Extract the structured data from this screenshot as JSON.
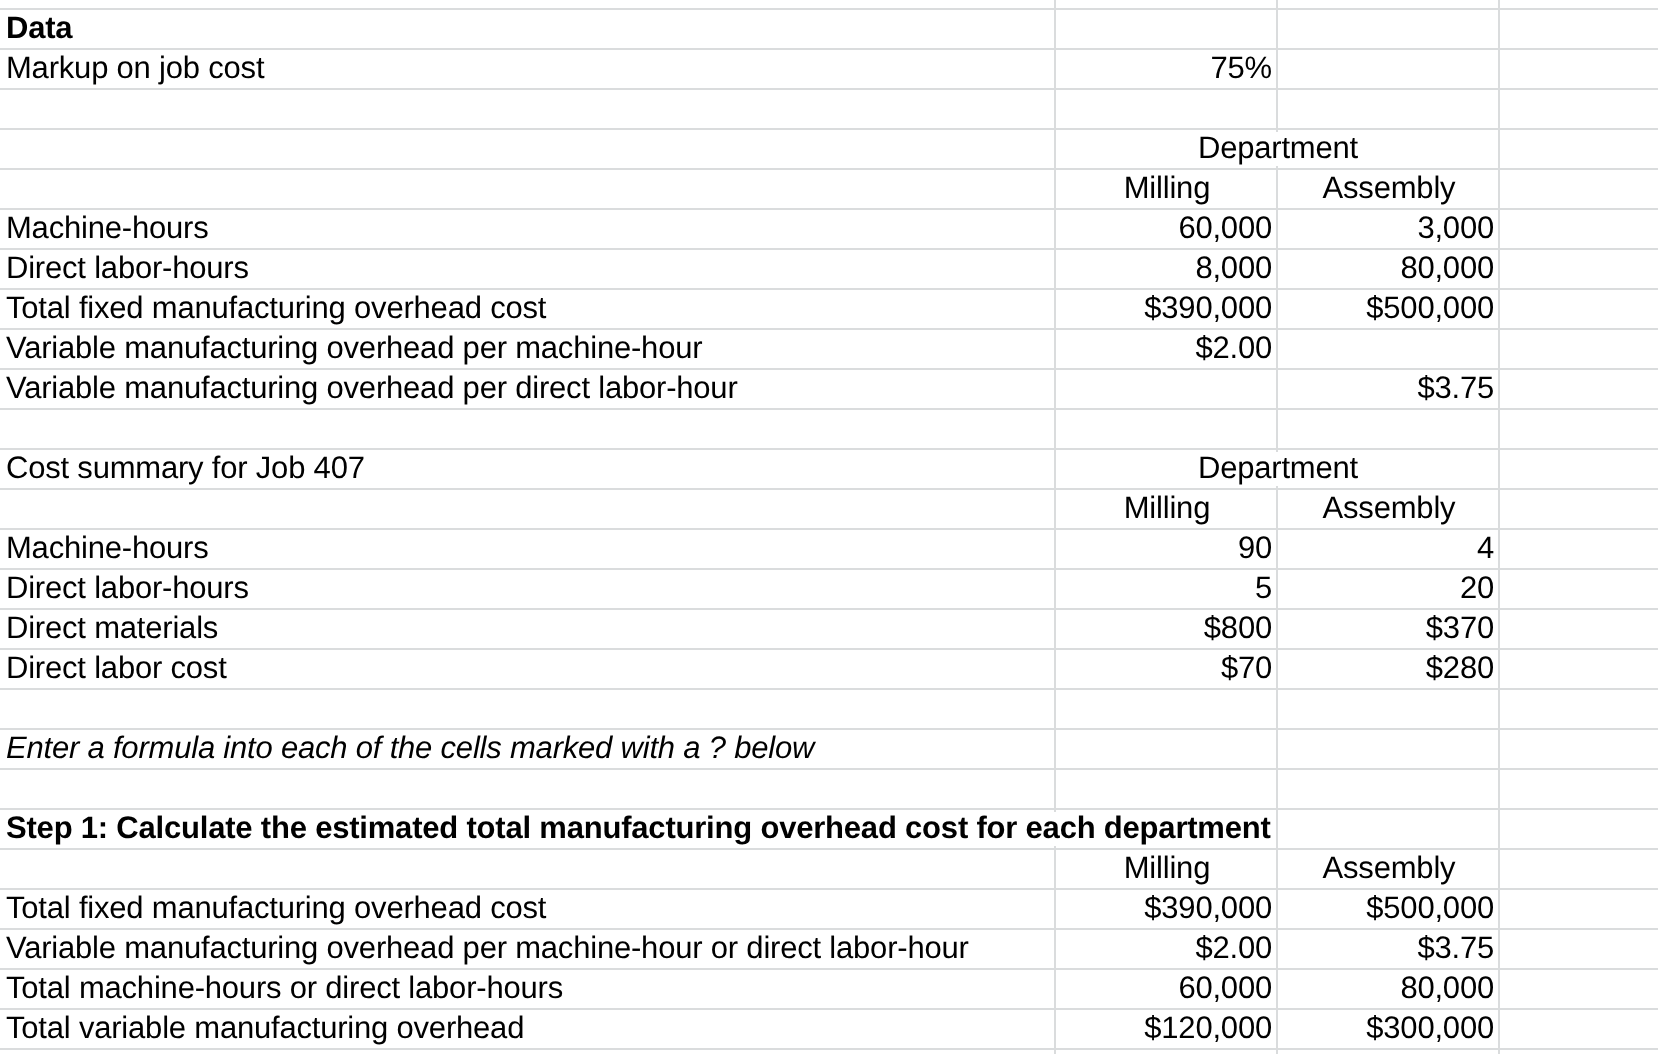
{
  "rows": [
    {
      "kind": "title",
      "label": "Data"
    },
    {
      "kind": "data",
      "label": "Markup on job cost",
      "milling": "75%"
    },
    {
      "kind": "blank"
    },
    {
      "kind": "header",
      "group": "Department"
    },
    {
      "kind": "columns",
      "milling": "Milling",
      "assembly": "Assembly"
    },
    {
      "kind": "data",
      "label": "Machine-hours",
      "milling": "60,000",
      "assembly": "3,000"
    },
    {
      "kind": "data",
      "label": "Direct labor-hours",
      "milling": "8,000",
      "assembly": "80,000"
    },
    {
      "kind": "data",
      "label": "Total fixed manufacturing overhead cost",
      "milling": "$390,000",
      "assembly": "$500,000"
    },
    {
      "kind": "data",
      "label": "Variable manufacturing overhead per machine-hour",
      "milling": "$2.00"
    },
    {
      "kind": "data",
      "label": "Variable manufacturing overhead per direct labor-hour",
      "assembly": "$3.75"
    },
    {
      "kind": "blank"
    },
    {
      "kind": "header",
      "label": "Cost summary for Job 407",
      "group": "Department"
    },
    {
      "kind": "columns",
      "milling": "Milling",
      "assembly": "Assembly"
    },
    {
      "kind": "data",
      "label": "Machine-hours",
      "milling": "90",
      "assembly": "4"
    },
    {
      "kind": "data",
      "label": "Direct labor-hours",
      "milling": "5",
      "assembly": "20"
    },
    {
      "kind": "data",
      "label": "Direct materials",
      "milling": "$800",
      "assembly": "$370"
    },
    {
      "kind": "data",
      "label": "Direct labor cost",
      "milling": "$70",
      "assembly": "$280"
    },
    {
      "kind": "blank"
    },
    {
      "kind": "note",
      "label": "Enter a formula into each of the cells marked with a ? below"
    },
    {
      "kind": "blank"
    },
    {
      "kind": "title",
      "label": "Step 1: Calculate the estimated total manufacturing overhead cost for each department"
    },
    {
      "kind": "columns",
      "milling": "Milling",
      "assembly": "Assembly"
    },
    {
      "kind": "data",
      "label": "Total fixed manufacturing overhead cost",
      "milling": "$390,000",
      "assembly": "$500,000"
    },
    {
      "kind": "data",
      "label": "Variable manufacturing overhead per machine-hour or direct labor-hour",
      "milling": "$2.00",
      "assembly": "$3.75"
    },
    {
      "kind": "data",
      "label": "Total machine-hours or direct labor-hours",
      "milling": "60,000",
      "assembly": "80,000"
    },
    {
      "kind": "data",
      "label": "Total variable manufacturing overhead",
      "milling": "$120,000",
      "assembly": "$300,000"
    }
  ]
}
